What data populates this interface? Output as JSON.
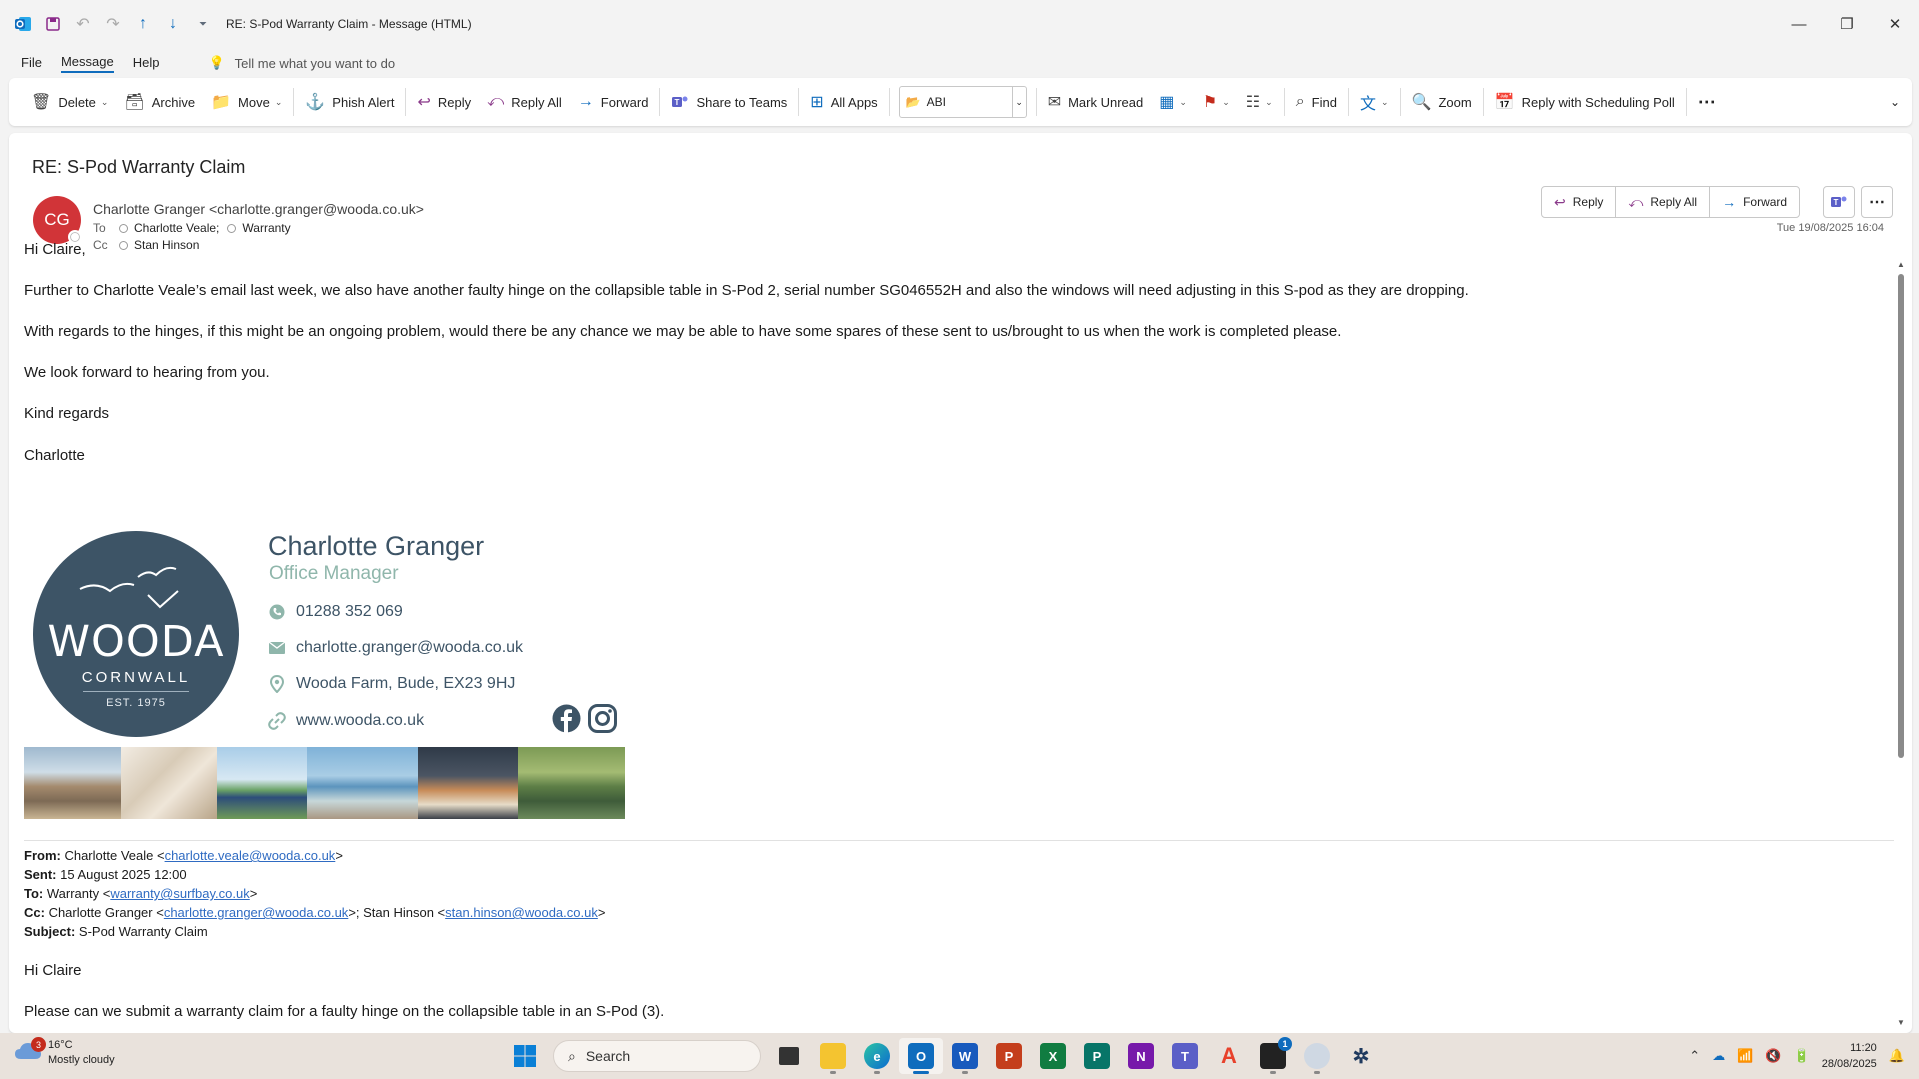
{
  "window": {
    "title": "RE: S-Pod Warranty Claim  -  Message (HTML)"
  },
  "menu": {
    "items": [
      "File",
      "Message",
      "Help"
    ],
    "active": "Message",
    "tell_me": "Tell me what you want to do"
  },
  "ribbon": {
    "delete": "Delete",
    "archive": "Archive",
    "move": "Move",
    "phish_alert": "Phish Alert",
    "reply": "Reply",
    "reply_all": "Reply All",
    "forward": "Forward",
    "share_to_teams": "Share to Teams",
    "all_apps": "All Apps",
    "abi": "ABI",
    "mark_unread": "Mark Unread",
    "find": "Find",
    "zoom": "Zoom",
    "reply_scheduling_poll": "Reply with Scheduling Poll"
  },
  "message": {
    "subject": "RE: S-Pod Warranty Claim",
    "avatar_initials": "CG",
    "avatar_color": "#d13438",
    "sender": "Charlotte Granger <charlotte.granger@wooda.co.uk>",
    "to_label": "To",
    "to": [
      "Charlotte Veale;",
      "Warranty"
    ],
    "cc_label": "Cc",
    "cc": [
      "Stan Hinson"
    ],
    "date": "Tue 19/08/2025 16:04",
    "actions": {
      "reply": "Reply",
      "reply_all": "Reply All",
      "forward": "Forward"
    },
    "body": [
      "Hi Claire,",
      "Further to Charlotte Veale’s email last week, we also have another faulty hinge on the collapsible table in S-Pod 2, serial number SG046552H and also the windows will need adjusting in this S-pod as they are dropping.",
      "With regards to the hinges, if this might be an ongoing problem, would there be any chance we may be able to have some spares of these sent to us/brought to us when the work is completed please.",
      "We look forward to hearing from you.",
      "Kind regards",
      "Charlotte"
    ]
  },
  "signature": {
    "logo_main": "WOODA",
    "logo_sub": "CORNWALL",
    "logo_est": "EST. 1975",
    "name": "Charlotte Granger",
    "role": "Office Manager",
    "phone": "01288 352 069",
    "email": "charlotte.granger@wooda.co.uk",
    "address": "Wooda Farm, Bude, EX23 9HJ",
    "website": "www.wooda.co.uk",
    "brand_color": "#3d5466",
    "accent_color": "#8fb6ab"
  },
  "forwarded": {
    "from_label": "From:",
    "from_name": " Charlotte Veale <",
    "from_email": "charlotte.veale@wooda.co.uk",
    "sent_label": "Sent:",
    "sent": " 15 August 2025 12:00",
    "to_label": "To:",
    "to_name": " Warranty <",
    "to_email": "warranty@surfbay.co.uk",
    "cc_label": "Cc:",
    "cc_name1": " Charlotte Granger <",
    "cc_email1": "charlotte.granger@wooda.co.uk",
    "cc_name2": ">; Stan Hinson <",
    "cc_email2": "stan.hinson@wooda.co.uk",
    "subject_label": "Subject:",
    "subject": " S-Pod Warranty Claim",
    "greeting": "Hi Claire",
    "line1": "Please can we submit a warranty claim for a faulty hinge on the collapsible table in an S-Pod (3)."
  },
  "taskbar": {
    "weather_temp": "16°C",
    "weather_desc": "Mostly cloudy",
    "weather_badge": "3",
    "search_placeholder": "Search",
    "teams_badge": "1",
    "time": "11:20",
    "date": "28/08/2025"
  }
}
